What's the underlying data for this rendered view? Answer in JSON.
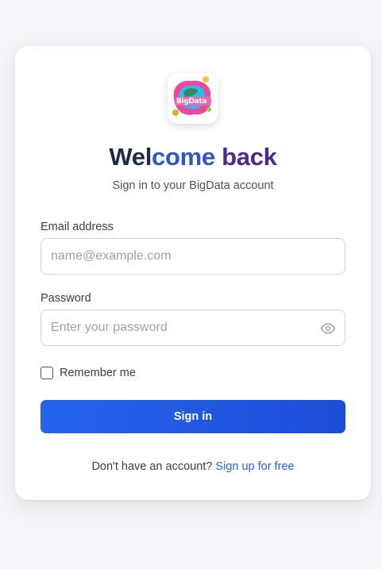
{
  "header": {
    "logo_icon": "bigdata-logo",
    "title_part1": "Wel",
    "title_part2": "come",
    "title_part3": " back",
    "subtitle": "Sign in to your BigData account"
  },
  "form": {
    "email_label": "Email address",
    "email_placeholder": "name@example.com",
    "email_value": "",
    "password_label": "Password",
    "password_placeholder": "Enter your password",
    "password_value": "",
    "password_toggle_icon": "eye-icon",
    "remember_label": "Remember me",
    "remember_checked": false,
    "submit_label": "Sign in"
  },
  "footer": {
    "prompt": "Don't have an account? ",
    "signup_link": "Sign up for free"
  },
  "colors": {
    "primary": "#2563eb",
    "title_dark": "#1e2a4a",
    "title_blue": "#2f56c6",
    "title_purple": "#4a2a8a",
    "page_background": "#f4f6f9"
  }
}
